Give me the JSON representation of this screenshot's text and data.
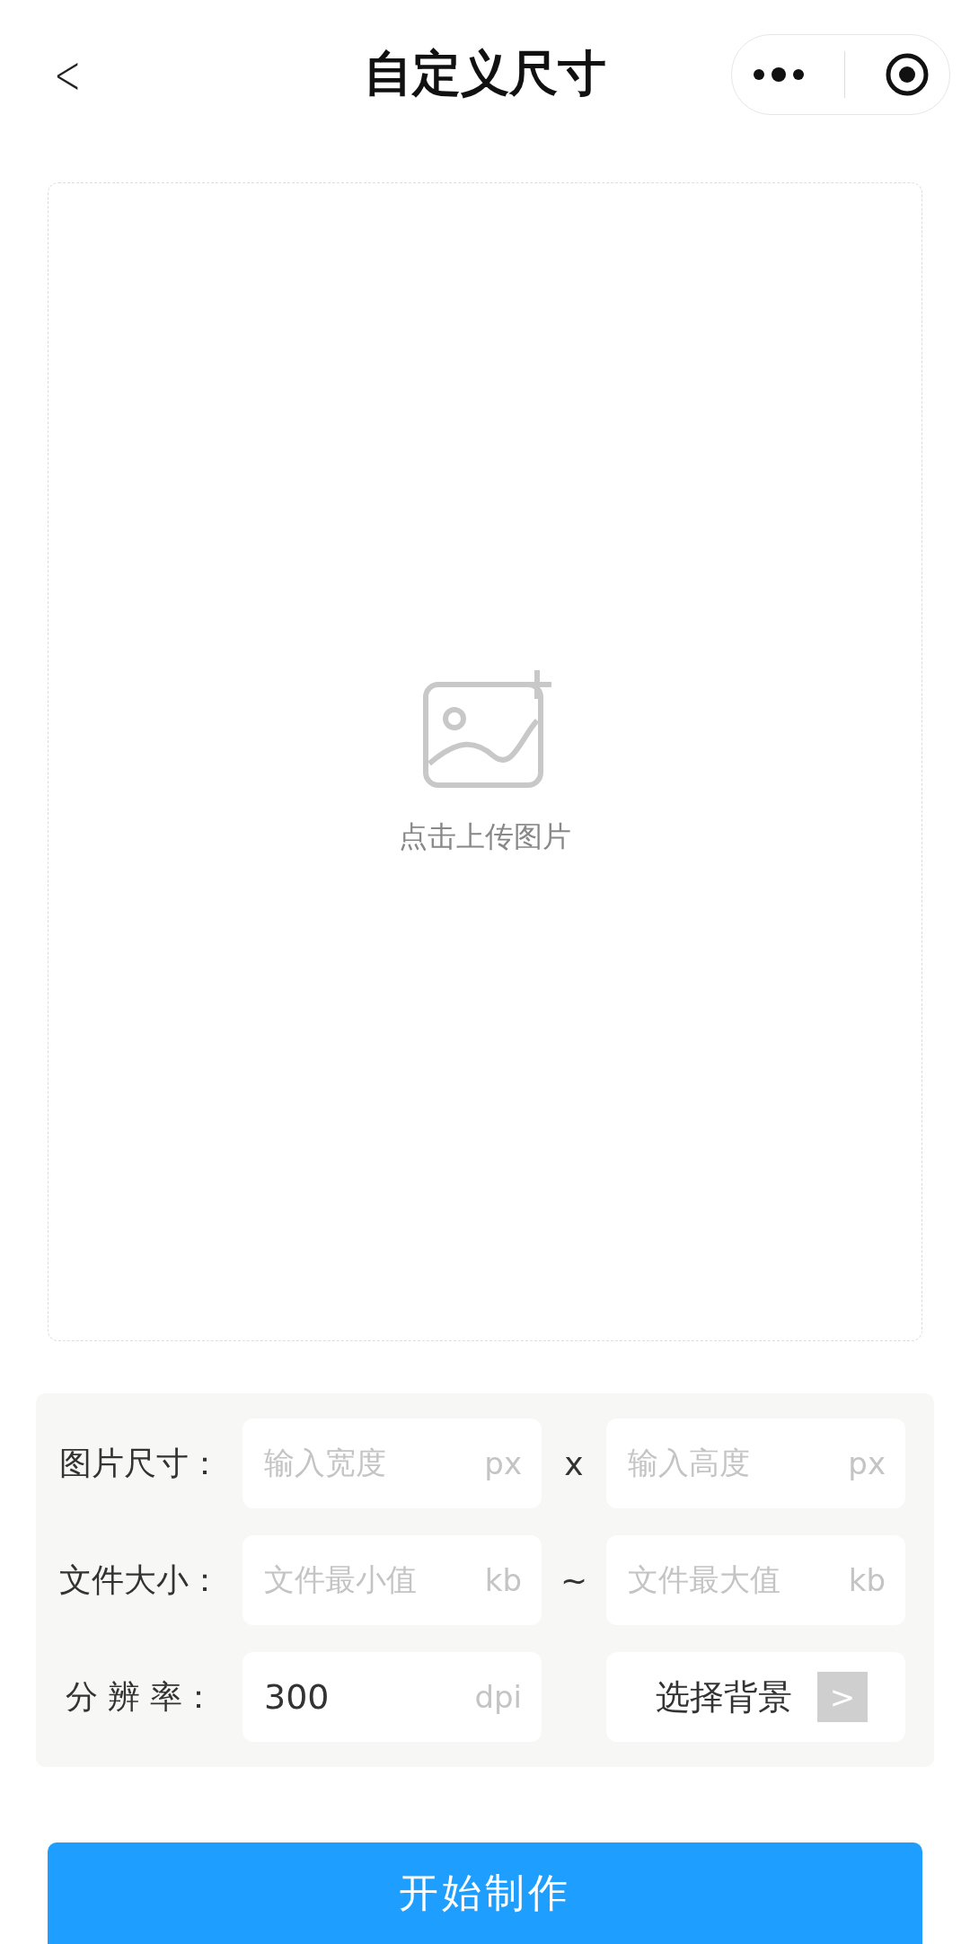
{
  "nav": {
    "back": "<",
    "title": "自定义尺寸"
  },
  "upload": {
    "label": "点击上传图片"
  },
  "form": {
    "rows": [
      {
        "kind": "pair",
        "label": "图片尺寸：",
        "separator": "x",
        "fields": [
          {
            "placeholder": "输入宽度",
            "unit": "px"
          },
          {
            "placeholder": "输入高度",
            "unit": "px"
          }
        ]
      },
      {
        "kind": "pair",
        "label": "文件大小：",
        "separator": "~",
        "fields": [
          {
            "placeholder": "文件最小值",
            "unit": "kb"
          },
          {
            "placeholder": "文件最大值",
            "unit": "kb"
          }
        ]
      },
      {
        "kind": "value-select",
        "label": "分 辨 率：",
        "field": {
          "value": "300",
          "unit": "dpi"
        },
        "select": {
          "label": "选择背景",
          "arrow": ">"
        }
      }
    ]
  },
  "submit": {
    "label": "开始制作"
  }
}
